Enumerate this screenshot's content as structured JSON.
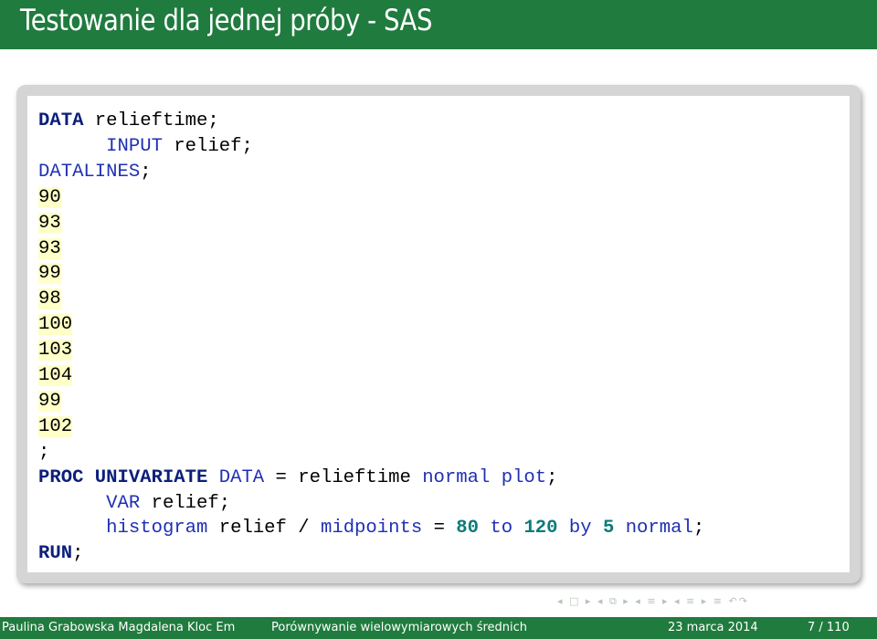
{
  "slide": {
    "title": "Testowanie dla jednej próby - SAS"
  },
  "code": {
    "lines": [
      [
        {
          "t": "DATA",
          "c": "kw"
        },
        {
          "t": " relieftime;",
          "c": "id"
        }
      ],
      [
        {
          "t": "      ",
          "c": ""
        },
        {
          "t": "INPUT",
          "c": "sk"
        },
        {
          "t": " relief;",
          "c": "id"
        }
      ],
      [
        {
          "t": "DATALINES",
          "c": "sk"
        },
        {
          "t": ";",
          "c": "id"
        }
      ],
      [
        {
          "t": "90",
          "c": "data"
        }
      ],
      [
        {
          "t": "93",
          "c": "data"
        }
      ],
      [
        {
          "t": "93",
          "c": "data"
        }
      ],
      [
        {
          "t": "99",
          "c": "data"
        }
      ],
      [
        {
          "t": "98",
          "c": "data"
        }
      ],
      [
        {
          "t": "100",
          "c": "data"
        }
      ],
      [
        {
          "t": "103",
          "c": "data"
        }
      ],
      [
        {
          "t": "104",
          "c": "data"
        }
      ],
      [
        {
          "t": "99",
          "c": "data"
        }
      ],
      [
        {
          "t": "102",
          "c": "data"
        }
      ],
      [
        {
          "t": ";",
          "c": "id"
        }
      ],
      [
        {
          "t": "PROC UNIVARIATE",
          "c": "kw"
        },
        {
          "t": " ",
          "c": ""
        },
        {
          "t": "DATA",
          "c": "sk"
        },
        {
          "t": " = relieftime ",
          "c": "id"
        },
        {
          "t": "normal",
          "c": "sk"
        },
        {
          "t": " ",
          "c": ""
        },
        {
          "t": "plot",
          "c": "sk"
        },
        {
          "t": ";",
          "c": "id"
        }
      ],
      [
        {
          "t": "      ",
          "c": ""
        },
        {
          "t": "VAR",
          "c": "sk"
        },
        {
          "t": " relief;",
          "c": "id"
        }
      ],
      [
        {
          "t": "      ",
          "c": ""
        },
        {
          "t": "histogram",
          "c": "sk"
        },
        {
          "t": " relief / ",
          "c": "id"
        },
        {
          "t": "midpoints",
          "c": "sk"
        },
        {
          "t": " = ",
          "c": "id"
        },
        {
          "t": "80",
          "c": "num"
        },
        {
          "t": " ",
          "c": ""
        },
        {
          "t": "to",
          "c": "sk"
        },
        {
          "t": " ",
          "c": ""
        },
        {
          "t": "120",
          "c": "num"
        },
        {
          "t": " ",
          "c": ""
        },
        {
          "t": "by",
          "c": "sk"
        },
        {
          "t": " ",
          "c": ""
        },
        {
          "t": "5",
          "c": "num"
        },
        {
          "t": " ",
          "c": ""
        },
        {
          "t": "normal",
          "c": "sk"
        },
        {
          "t": ";",
          "c": "id"
        }
      ],
      [
        {
          "t": "RUN",
          "c": "kw"
        },
        {
          "t": ";",
          "c": "id"
        }
      ]
    ]
  },
  "nav": {
    "symbols": "◂ □ ▸ ◂ ⧉ ▸ ◂ ≡ ▸ ◂ ≡ ▸ ≡ ↶↷"
  },
  "footer": {
    "authors": "Paulina Grabowska Magdalena Kloc Em",
    "title": "Porównywanie wielowymiarowych średnich",
    "date": "23 marca 2014",
    "page": "7 / 110"
  }
}
